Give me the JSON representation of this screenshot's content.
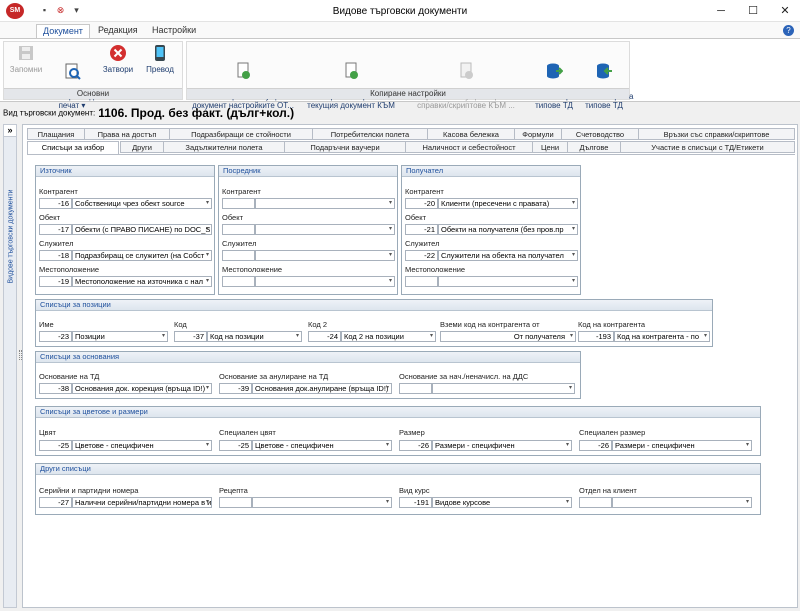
{
  "app": {
    "title": "Видове търговски документи",
    "logo": "SM"
  },
  "ribbon_tabs": [
    "Документ",
    "Редакция",
    "Настройки"
  ],
  "ribbon": {
    "groups": [
      {
        "label": "Основни",
        "buttons": [
          "Запомни",
          "Преглед\nпечат ▾",
          "Затвори",
          "Превод"
        ]
      },
      {
        "label": "Копиране настройки",
        "buttons": [
          "Копирай в текущия\nдокумент настройките ОТ...",
          "Копирай настройките от\nтекущия документ КЪМ",
          "Прикачи текущата връзка със\nсправки/скриптове КЪМ ...",
          "Експорт на\nтипове ТД",
          "Импорт на\nтипове ТД"
        ]
      }
    ]
  },
  "doc_type": {
    "label": "Вид търговски документ:",
    "value": "1106. Прод. без факт. (дълг+кол.)"
  },
  "sidebar": {
    "toggle": "»",
    "label": "Видове търговски документи"
  },
  "tabs_row1": [
    "Плащания",
    "Права на достъп",
    "Подразбиращи се стойности",
    "Потребителски полета",
    "Касова бележка",
    "Формули",
    "Счетоводство",
    "Връзки със справки/скриптове"
  ],
  "tabs_row2": [
    "Списъци за избор",
    "Други",
    "Задължителни полета",
    "Подаръчни ваучери",
    "Наличност и себестойност",
    "Цени",
    "Дългове",
    "Участие в списъци с ТД/Етикети"
  ],
  "panels": {
    "source": {
      "title": "Източник",
      "fields": [
        {
          "label": "Контрагент",
          "num": "-16",
          "value": "Собственици чрез обект source"
        },
        {
          "label": "Обект",
          "num": "-17",
          "value": "Обекти (с ПРАВО ПИСАНЕ) по DOC_S"
        },
        {
          "label": "Служител",
          "num": "-18",
          "value": "Подразбиращ се служител (на Собст"
        },
        {
          "label": "Местоположение",
          "num": "-19",
          "value": "Местоположение на източника с нал"
        }
      ]
    },
    "intermediary": {
      "title": "Посредник",
      "fields": [
        {
          "label": "Контрагент",
          "num": "",
          "value": ""
        },
        {
          "label": "Обект",
          "num": "",
          "value": ""
        },
        {
          "label": "Служител",
          "num": "",
          "value": ""
        },
        {
          "label": "Местоположение",
          "num": "",
          "value": ""
        }
      ]
    },
    "recipient": {
      "title": "Получател",
      "fields": [
        {
          "label": "Контрагент",
          "num": "-20",
          "value": "Клиенти (пресечени с правата)"
        },
        {
          "label": "Обект",
          "num": "-21",
          "value": "Обекти на получателя (без пров.пр"
        },
        {
          "label": "Служител",
          "num": "-22",
          "value": "Служители на обекта на получател"
        },
        {
          "label": "Местоположение",
          "num": "",
          "value": ""
        }
      ]
    },
    "positions": {
      "title": "Списъци за позиции",
      "fields": [
        {
          "label": "Име",
          "num": "-23",
          "value": "Позиции"
        },
        {
          "label": "Код",
          "num": "-37",
          "value": "Код на позиции"
        },
        {
          "label": "Код 2",
          "num": "-24",
          "value": "Код 2 на позиции"
        },
        {
          "label": "Вземи код на контрагента от",
          "num": "",
          "value": "От получателя"
        },
        {
          "label": "Код на контрагента",
          "num": "-193",
          "value": "Код на контрагента - по"
        }
      ]
    },
    "grounds": {
      "title": "Списъци за основания",
      "fields": [
        {
          "label": "Основание на ТД",
          "num": "-38",
          "value": "Основания док. корекция (връща ID!)"
        },
        {
          "label": "Основание за анулиране на ТД",
          "num": "-39",
          "value": "Основания док.анулиране (връща ID!)"
        },
        {
          "label": "Основание за нач./неначисл. на ДДС",
          "num": "",
          "value": ""
        }
      ]
    },
    "colors_sizes": {
      "title": "Списъци за цветове и размери",
      "fields": [
        {
          "label": "Цвят",
          "num": "-25",
          "value": "Цветове - специфичен"
        },
        {
          "label": "Специален цвят",
          "num": "-25",
          "value": "Цветове - специфичен"
        },
        {
          "label": "Размер",
          "num": "-26",
          "value": "Размери - специфичен"
        },
        {
          "label": "Специален размер",
          "num": "-26",
          "value": "Размери - специфичен"
        }
      ]
    },
    "other": {
      "title": "Други списъци",
      "fields": [
        {
          "label": "Серийни и партидни номера",
          "num": "-27",
          "value": "Налични серийни/партидни номера в и"
        },
        {
          "label": "Рецепта",
          "num": "",
          "value": ""
        },
        {
          "label": "Вид курс",
          "num": "-191",
          "value": "Видове курсове"
        },
        {
          "label": "Отдел на клиент",
          "num": "",
          "value": ""
        }
      ]
    }
  }
}
